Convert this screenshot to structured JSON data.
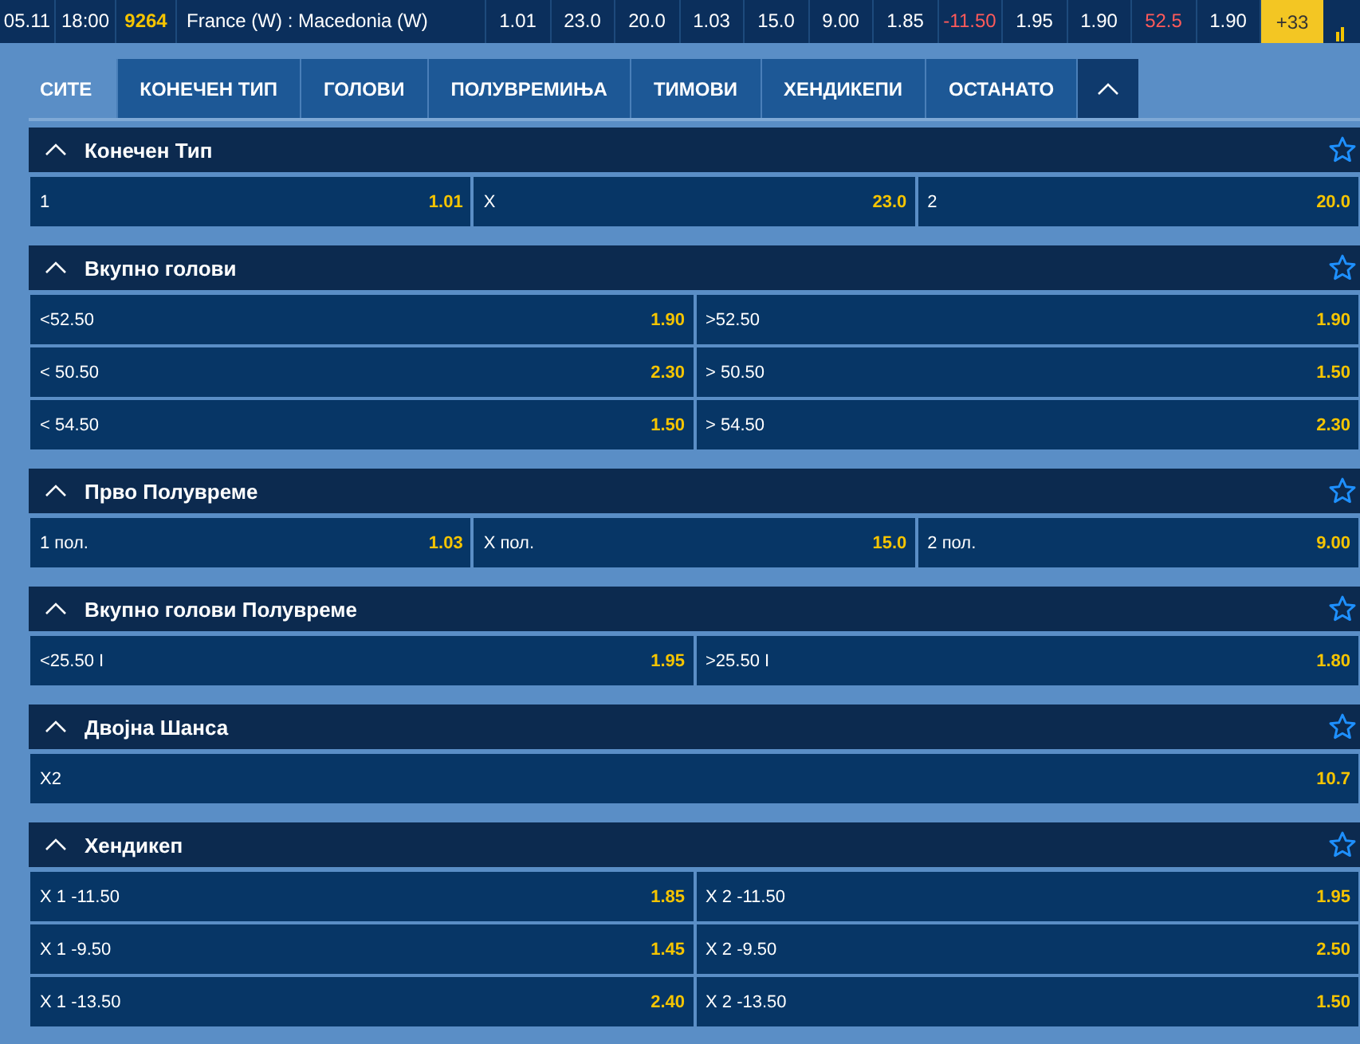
{
  "top_bar": {
    "date": "05.11",
    "time": "18:00",
    "code": "9264",
    "match": "France (W) : Macedonia (W)",
    "more": "+33",
    "odds": [
      {
        "value": "1.01",
        "negative": false
      },
      {
        "value": "23.0",
        "negative": false
      },
      {
        "value": "20.0",
        "negative": false
      },
      {
        "value": "1.03",
        "negative": false
      },
      {
        "value": "15.0",
        "negative": false
      },
      {
        "value": "9.00",
        "negative": false
      },
      {
        "value": "1.85",
        "negative": false
      },
      {
        "value": "-11.50",
        "negative": true
      },
      {
        "value": "1.95",
        "negative": false
      },
      {
        "value": "1.90",
        "negative": false
      },
      {
        "value": "52.5",
        "negative": true
      },
      {
        "value": "1.90",
        "negative": false
      }
    ]
  },
  "tabs": [
    {
      "label": "СИТЕ",
      "selected": true
    },
    {
      "label": "КОНЕЧЕН ТИП",
      "selected": false
    },
    {
      "label": "ГОЛОВИ",
      "selected": false
    },
    {
      "label": "ПОЛУВРЕМИЊА",
      "selected": false
    },
    {
      "label": "ТИМОВИ",
      "selected": false
    },
    {
      "label": "ХЕНДИКЕПИ",
      "selected": false
    },
    {
      "label": "ОСТАНАТО",
      "selected": false
    }
  ],
  "markets": [
    {
      "title": "Конечен Тип",
      "expanded": true,
      "rows": [
        [
          {
            "label": "1",
            "odds": "1.01"
          },
          {
            "label": "X",
            "odds": "23.0"
          },
          {
            "label": "2",
            "odds": "20.0"
          }
        ]
      ]
    },
    {
      "title": "Вкупно голови",
      "expanded": true,
      "rows": [
        [
          {
            "label": "<52.50",
            "odds": "1.90"
          },
          {
            "label": ">52.50",
            "odds": "1.90"
          }
        ],
        [
          {
            "label": "< 50.50",
            "odds": "2.30"
          },
          {
            "label": "> 50.50",
            "odds": "1.50"
          }
        ],
        [
          {
            "label": "< 54.50",
            "odds": "1.50"
          },
          {
            "label": "> 54.50",
            "odds": "2.30"
          }
        ]
      ]
    },
    {
      "title": "Прво Полувреме",
      "expanded": true,
      "rows": [
        [
          {
            "label": "1 пол.",
            "odds": "1.03"
          },
          {
            "label": "X пол.",
            "odds": "15.0"
          },
          {
            "label": "2 пол.",
            "odds": "9.00"
          }
        ]
      ]
    },
    {
      "title": "Вкупно голови Полувреме",
      "expanded": true,
      "rows": [
        [
          {
            "label": "<25.50 I",
            "odds": "1.95"
          },
          {
            "label": ">25.50 I",
            "odds": "1.80"
          }
        ]
      ]
    },
    {
      "title": "Двојна Шанса",
      "expanded": true,
      "rows": [
        [
          {
            "label": "X2",
            "odds": "10.7"
          }
        ]
      ]
    },
    {
      "title": "Хендикеп",
      "expanded": true,
      "rows": [
        [
          {
            "label": "X 1 -11.50",
            "odds": "1.85"
          },
          {
            "label": "X 2 -11.50",
            "odds": "1.95"
          }
        ],
        [
          {
            "label": "X 1 -9.50",
            "odds": "1.45"
          },
          {
            "label": "X 2 -9.50",
            "odds": "2.50"
          }
        ],
        [
          {
            "label": "X 1 -13.50",
            "odds": "2.40"
          },
          {
            "label": "X 2 -13.50",
            "odds": "1.50"
          }
        ]
      ]
    }
  ]
}
